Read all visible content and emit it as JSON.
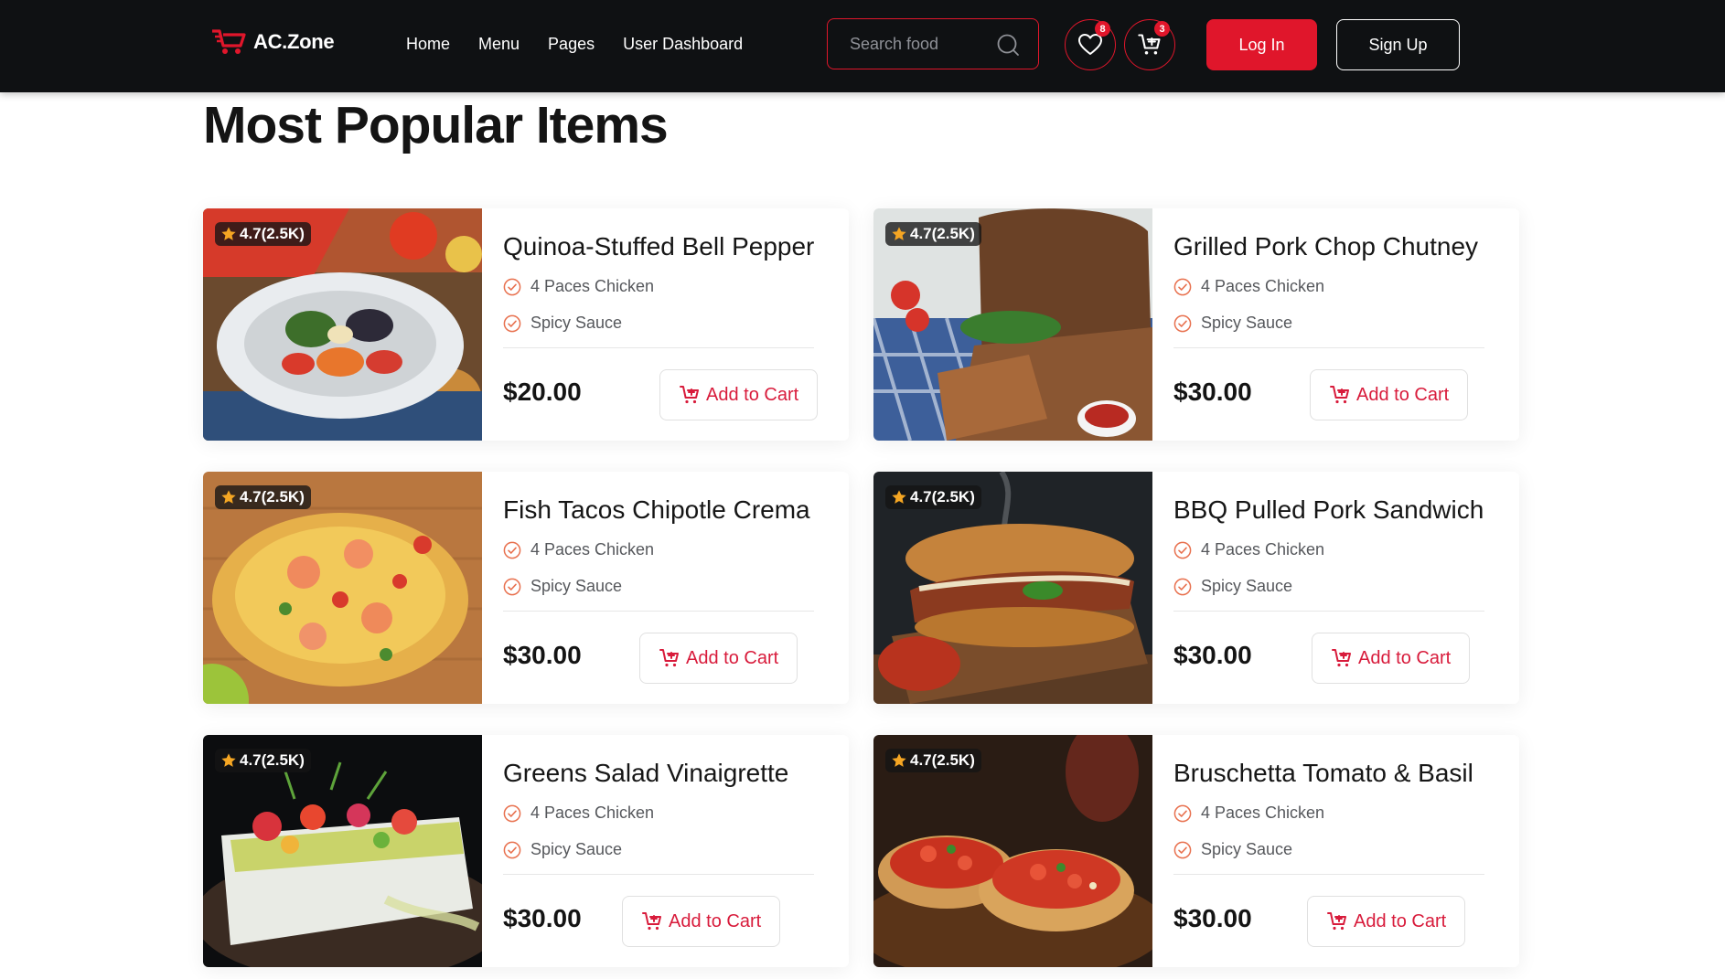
{
  "app": {
    "logo_text": "AC.Zone",
    "brand_color": "#e0162b",
    "header_bg": "#0f1113"
  },
  "nav": {
    "items": [
      "Home",
      "Menu",
      "Pages",
      "User Dashboard"
    ]
  },
  "search": {
    "placeholder": "Search food",
    "icon": "search-icon"
  },
  "header_actions": {
    "wishlist_count": "8",
    "cart_count": "3",
    "login_label": "Log In",
    "signup_label": "Sign Up"
  },
  "section": {
    "title": "Most Popular Items"
  },
  "items": [
    {
      "name": "Quinoa-Stuffed Bell Pepper",
      "rating": "4.7(2.5K)",
      "features": [
        "4 Paces Chicken",
        "Spicy Sauce"
      ],
      "price": "$20.00",
      "cart_label": "Add to Cart"
    },
    {
      "name": "Grilled Pork Chop Chutney",
      "rating": "4.7(2.5K)",
      "features": [
        "4 Paces Chicken",
        "Spicy Sauce"
      ],
      "price": "$30.00",
      "cart_label": "Add to Cart"
    },
    {
      "name": "Fish Tacos Chipotle Crema",
      "rating": "4.7(2.5K)",
      "features": [
        "4 Paces Chicken",
        "Spicy Sauce"
      ],
      "price": "$30.00",
      "cart_label": "Add to Cart"
    },
    {
      "name": "BBQ Pulled Pork Sandwich",
      "rating": "4.7(2.5K)",
      "features": [
        "4 Paces Chicken",
        "Spicy Sauce"
      ],
      "price": "$30.00",
      "cart_label": "Add to Cart"
    },
    {
      "name": "Greens Salad Vinaigrette",
      "rating": "4.7(2.5K)",
      "features": [
        "4 Paces Chicken",
        "Spicy Sauce"
      ],
      "price": "$30.00",
      "cart_label": "Add to Cart"
    },
    {
      "name": "Bruschetta Tomato & Basil",
      "rating": "4.7(2.5K)",
      "features": [
        "4 Paces Chicken",
        "Spicy Sauce"
      ],
      "price": "$30.00",
      "cart_label": "Add to Cart"
    }
  ]
}
